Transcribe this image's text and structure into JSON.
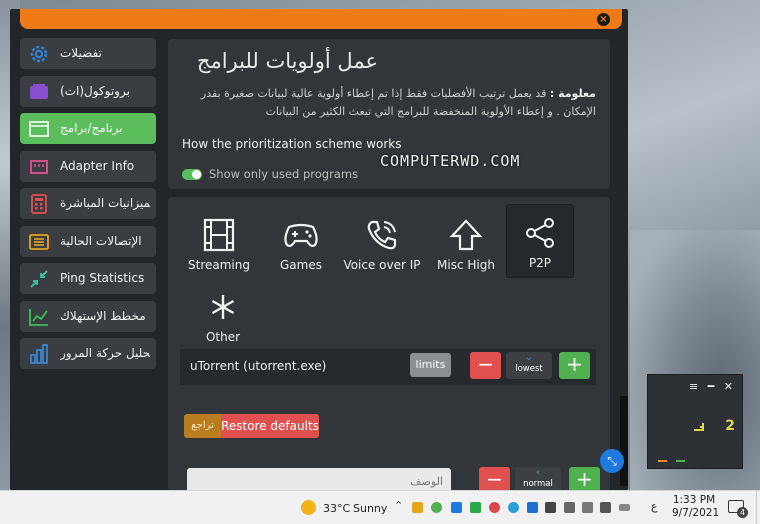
{
  "window": {
    "close_glyph": "×"
  },
  "sidebar": {
    "items": [
      {
        "label": "تفضيلات",
        "icon": "gear-icon",
        "color": "#2f86d6"
      },
      {
        "label": "بروتوكول(ات)",
        "icon": "protocol-icon",
        "color": "#8a4fd1"
      },
      {
        "label": "برنامج/برامج",
        "icon": "window-icon",
        "color": "#ffffff",
        "active": true
      },
      {
        "label": "Adapter Info",
        "icon": "ethernet-icon",
        "color": "#e84f8f"
      },
      {
        "label": "الميزانيات المباشرة",
        "icon": "calculator-icon",
        "color": "#e0504f"
      },
      {
        "label": "الإتصالات الحالية",
        "icon": "list-icon",
        "color": "#e6a41c"
      },
      {
        "label": "Ping Statistics",
        "icon": "shrink-icon",
        "color": "#3bbf9a"
      },
      {
        "label": "مخطط الإستهلاك",
        "icon": "trend-icon",
        "color": "#3bbf5a"
      },
      {
        "label": "تحليل حركة المرور",
        "icon": "bars-icon",
        "color": "#3a8fe0"
      }
    ]
  },
  "info_panel": {
    "title": "عمل أولويات للبرامج",
    "note_label": "معلومة :",
    "note_text": "قد يعمل ترتيب الأفضليات فقط إذا تم إعطاء أولوية عالية لبيانات صغيرة بقدر الإمكان . و إعطاء الأولوية المنخفضة للبرامج التي تبعث الكثير من البيانات",
    "how_link": "How the prioritization scheme works",
    "toggle_label": "Show only used programs",
    "toggle_on": true
  },
  "categories": [
    {
      "label": "Streaming",
      "icon": "film-icon"
    },
    {
      "label": "Games",
      "icon": "gamepad-icon"
    },
    {
      "label": "Voice over IP",
      "icon": "phone-icon"
    },
    {
      "label": "Misc High",
      "icon": "arrow-up-icon"
    },
    {
      "label": "P2P",
      "icon": "share-icon",
      "selected": true
    },
    {
      "label": "Other",
      "icon": "asterisk-icon"
    }
  ],
  "program_row": {
    "name": "uTorrent (utorrent.exe)",
    "limits_label": "limits",
    "minus_label": "−",
    "plus_label": "+",
    "priority": "lowest"
  },
  "actions": {
    "revert_label": "تراجع",
    "restore_label": "Restore defaults"
  },
  "new_row": {
    "placeholder": "الوصف",
    "minus_label": "−",
    "plus_label": "+",
    "priority": "normal"
  },
  "watermark": "COMPUTERWD.COM",
  "mini_widget": {
    "tools": "≡ ━ ✕",
    "value": "2"
  },
  "taskbar": {
    "temperature": "33°C",
    "weather": "Sunny",
    "language": "ع",
    "time": "1:33 PM",
    "date": "9/7/2021",
    "notification_count": "4"
  }
}
